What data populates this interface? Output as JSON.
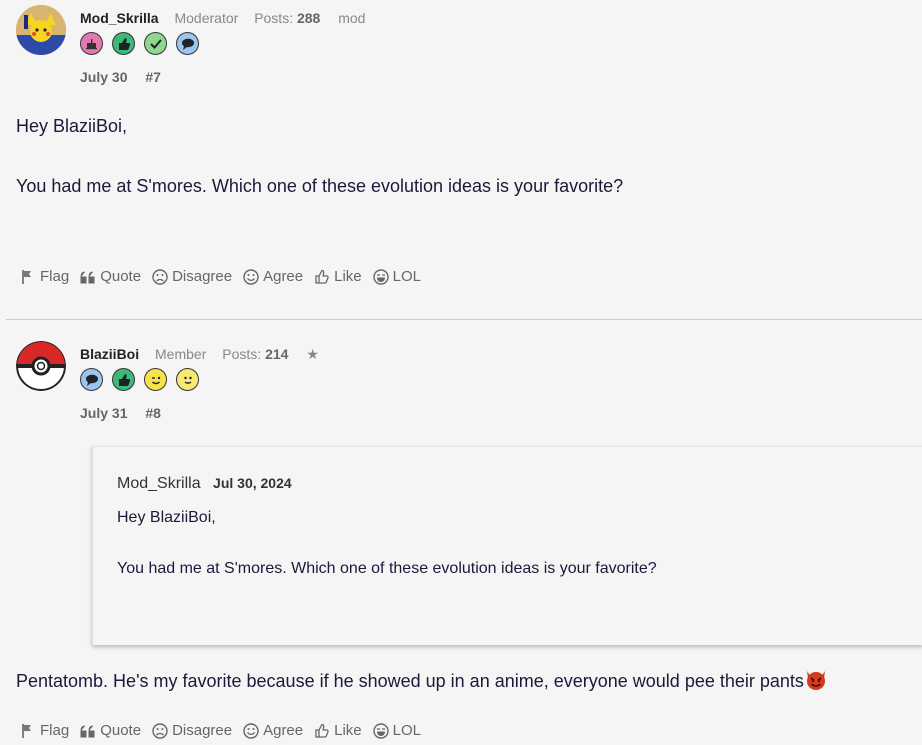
{
  "posts": [
    {
      "username": "Mod_Skrilla",
      "role": "Moderator",
      "posts_label": "Posts:",
      "posts_count": "288",
      "extra": "mod",
      "badges": [
        "cake-icon",
        "thumbs-up-icon",
        "check-icon",
        "speech-bubble-icon"
      ],
      "date": "July 30",
      "number": "#7",
      "body": [
        "Hey BlaziiBoi,",
        "You had me at S'mores. Which one of these evolution ideas is your favorite?"
      ]
    },
    {
      "username": "BlaziiBoi",
      "role": "Member",
      "posts_label": "Posts:",
      "posts_count": "214",
      "extra": "★",
      "badges": [
        "speech-bubble-icon",
        "thumbs-up-icon",
        "wink-icon",
        "smile-icon"
      ],
      "date": "July 31",
      "number": "#8",
      "quote": {
        "author": "Mod_Skrilla",
        "date": "Jul 30, 2024",
        "lines": [
          "Hey BlaziiBoi,",
          "You had me at S'mores. Which one of these evolution ideas is your favorite?"
        ]
      },
      "body": [
        "Pentatomb. He's my favorite because if he showed up in an anime, everyone would pee their pants"
      ],
      "emoji": "devil-emoji-icon"
    }
  ],
  "actions": {
    "flag": "Flag",
    "quote": "Quote",
    "disagree": "Disagree",
    "agree": "Agree",
    "like": "Like",
    "lol": "LOL"
  },
  "colors": {
    "background": "#f5f5f5",
    "text": "#1a1a3a",
    "muted": "#888888"
  }
}
